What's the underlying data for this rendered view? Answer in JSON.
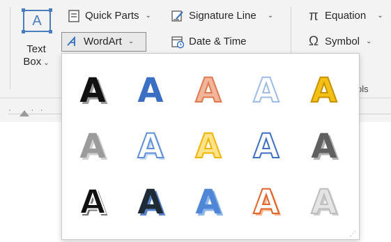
{
  "ribbon": {
    "text_box": {
      "icon_glyph": "A",
      "label_line1": "Text",
      "label_line2": "Box"
    },
    "quick_parts": {
      "label": "Quick Parts"
    },
    "wordart": {
      "label": "WordArt"
    },
    "signature_line": {
      "label": "Signature Line"
    },
    "date_time": {
      "label": "Date & Time"
    },
    "equation": {
      "label": "Equation",
      "symbol": "π"
    },
    "symbol": {
      "label": "Symbol",
      "symbol": "Ω"
    },
    "tools_group_label": "ols"
  },
  "wordart_gallery": {
    "glyph": "A",
    "styles": [
      {
        "name": "black-shadow",
        "fill": "#111111",
        "outline": "none",
        "shadow": "#9a9a9a"
      },
      {
        "name": "blue-gradient",
        "fill": "#3a6fc4",
        "outline": "none",
        "shadow": "none"
      },
      {
        "name": "orange-soft",
        "fill": "#f2b49a",
        "outline": "#e07a4e",
        "shadow": "none"
      },
      {
        "name": "blue-outline-light",
        "fill": "#ffffff",
        "outline": "#9dbde6",
        "shadow": "none"
      },
      {
        "name": "gold",
        "fill": "#f3c014",
        "outline": "#c89200",
        "shadow": "none"
      },
      {
        "name": "gray-gradient",
        "fill": "#9b9b9b",
        "outline": "none",
        "shadow": "#d0d0d0"
      },
      {
        "name": "blue-reflection",
        "fill": "#ffffff",
        "outline": "#5e8fd8",
        "shadow": "#c7daf4"
      },
      {
        "name": "gold-soft",
        "fill": "#fce38a",
        "outline": "#f0b400",
        "shadow": "none"
      },
      {
        "name": "blue-outline",
        "fill": "#ffffff",
        "outline": "#3d6fc2",
        "shadow": "none"
      },
      {
        "name": "gray-bevel",
        "fill": "#606060",
        "outline": "none",
        "shadow": "#b0b0b0"
      },
      {
        "name": "black-3d",
        "fill": "#111111",
        "outline": "#ffffff",
        "shadow": "#777777"
      },
      {
        "name": "black-blue-shadow",
        "fill": "#1f2a37",
        "outline": "none",
        "shadow": "#5a84c7"
      },
      {
        "name": "blue-3d",
        "fill": "#4f86d6",
        "outline": "none",
        "shadow": "#8fb6ea"
      },
      {
        "name": "orange-outline",
        "fill": "#ffffff",
        "outline": "#e2632a",
        "shadow": "#f4b48c"
      },
      {
        "name": "silver",
        "fill": "#e4e4e4",
        "outline": "#bdbdbd",
        "shadow": "#cfcfcf"
      }
    ]
  }
}
